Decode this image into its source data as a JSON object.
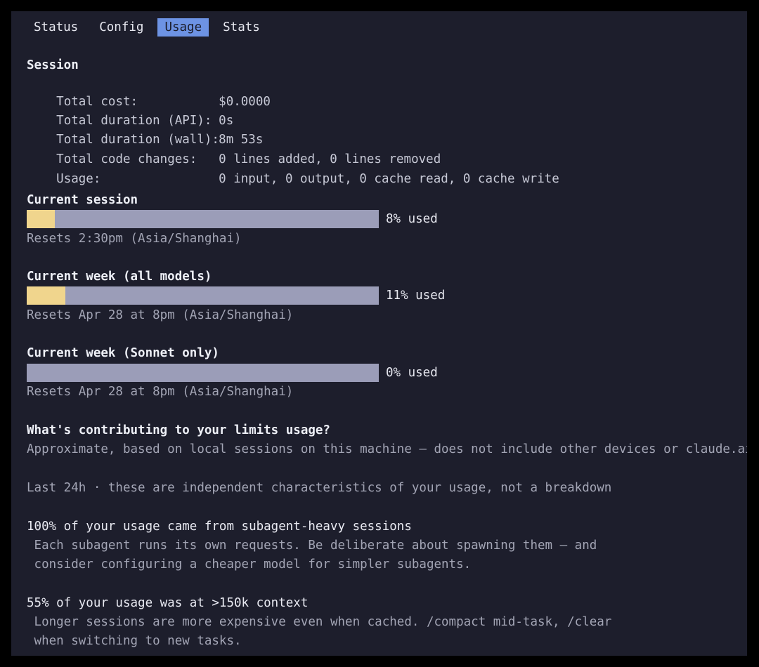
{
  "tabs": [
    {
      "label": "Status",
      "active": false
    },
    {
      "label": "Config",
      "active": false
    },
    {
      "label": "Usage",
      "active": true
    },
    {
      "label": "Stats",
      "active": false
    }
  ],
  "session": {
    "heading": "Session",
    "rows": [
      {
        "label": "Total cost:",
        "value": "$0.0000"
      },
      {
        "label": "Total duration (API):",
        "value": "0s"
      },
      {
        "label": "Total duration (wall):",
        "value": "8m 53s"
      },
      {
        "label": "Total code changes:",
        "value": "0 lines added, 0 lines removed"
      },
      {
        "label": "Usage:",
        "value": "0 input, 0 output, 0 cache read, 0 cache write"
      }
    ]
  },
  "limits": [
    {
      "title": "Current session",
      "percent": 8,
      "percent_label": "8% used",
      "resets": "Resets 2:30pm (Asia/Shanghai)"
    },
    {
      "title": "Current week (all models)",
      "percent": 11,
      "percent_label": "11% used",
      "resets": "Resets Apr 28 at 8pm (Asia/Shanghai)"
    },
    {
      "title": "Current week (Sonnet only)",
      "percent": 0,
      "percent_label": "0% used",
      "resets": "Resets Apr 28 at 8pm (Asia/Shanghai)"
    }
  ],
  "contributing": {
    "heading": "What's contributing to your limits usage?",
    "subtitle": "Approximate, based on local sessions on this machine — does not include other devices or claude.ai",
    "period": "Last 24h · these are independent characteristics of your usage, not a breakdown",
    "items": [
      {
        "headline": "100% of your usage came from subagent-heavy sessions",
        "detail_1": " Each subagent runs its own requests. Be deliberate about spawning them — and",
        "detail_2": " consider configuring a cheaper model for simpler subagents."
      },
      {
        "headline": "55% of your usage was at >150k context",
        "detail_1": " Longer sessions are more expensive even when cached. /compact mid-task, /clear",
        "detail_2": " when switching to new tasks."
      }
    ]
  },
  "colors": {
    "background": "#1d1e2c",
    "tab_active": "#6d93e4",
    "bar_track": "#9b9db8",
    "bar_fill": "#f0d58d"
  }
}
